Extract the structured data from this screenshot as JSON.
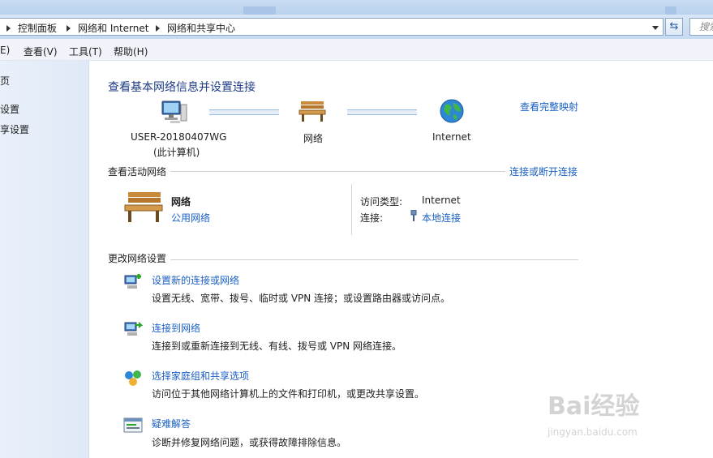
{
  "address": {
    "crumbs": [
      "控制面板",
      "网络和 Internet",
      "网络和共享中心"
    ],
    "search_placeholder": "搜索"
  },
  "menu": [
    "E)",
    "查看(V)",
    "工具(T)",
    "帮助(H)"
  ],
  "left_links": [
    "页",
    "设置",
    "享设置"
  ],
  "main": {
    "title": "查看基本网络信息并设置连接",
    "view_full_map": "查看完整映射",
    "map": {
      "computer_name": "USER-20180407WG",
      "computer_sub": "(此计算机)",
      "network": "网络",
      "internet": "Internet"
    },
    "active": {
      "section": "查看活动网络",
      "connect_link": "连接或断开连接",
      "name": "网络",
      "type": "公用网络",
      "access_label": "访问类型:",
      "access_value": "Internet",
      "conn_label": "连接:",
      "conn_value": "本地连接"
    },
    "change": {
      "section": "更改网络设置",
      "tasks": [
        {
          "title": "设置新的连接或网络",
          "desc": "设置无线、宽带、拨号、临时或 VPN 连接；或设置路由器或访问点。",
          "icon": "new-connection-icon"
        },
        {
          "title": "连接到网络",
          "desc": "连接到或重新连接到无线、有线、拨号或 VPN 网络连接。",
          "icon": "connect-network-icon"
        },
        {
          "title": "选择家庭组和共享选项",
          "desc": "访问位于其他网络计算机上的文件和打印机，或更改共享设置。",
          "icon": "homegroup-icon"
        },
        {
          "title": "疑难解答",
          "desc": "诊断并修复网络问题，或获得故障排除信息。",
          "icon": "troubleshoot-icon"
        }
      ]
    }
  },
  "watermark": {
    "brand": "Bai经验",
    "url": "jingyan.baidu.com"
  }
}
